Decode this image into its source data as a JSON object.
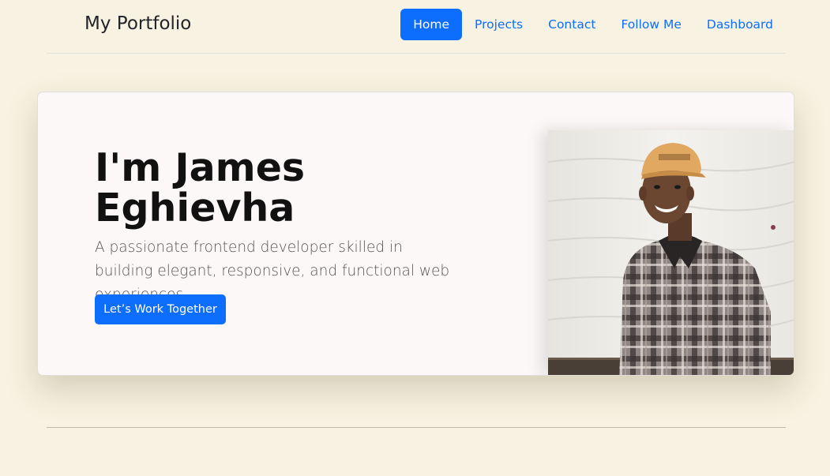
{
  "nav": {
    "brand": "My Portfolio",
    "links": [
      {
        "label": "Home",
        "active": true
      },
      {
        "label": "Projects",
        "active": false
      },
      {
        "label": "Contact",
        "active": false
      },
      {
        "label": "Follow Me",
        "active": false
      },
      {
        "label": "Dashboard",
        "active": false
      }
    ]
  },
  "hero": {
    "title": "I'm James Eghievha",
    "subtitle": "A passionate frontend developer skilled in building elegant, responsive, and functional web experiences.",
    "cta_label": "Let’s Work Together",
    "photo_subject": "profile-photo"
  },
  "colors": {
    "page_bg": "#f7f2e1",
    "card_bg": "#fcf8f8",
    "accent": "#0d6efd"
  }
}
